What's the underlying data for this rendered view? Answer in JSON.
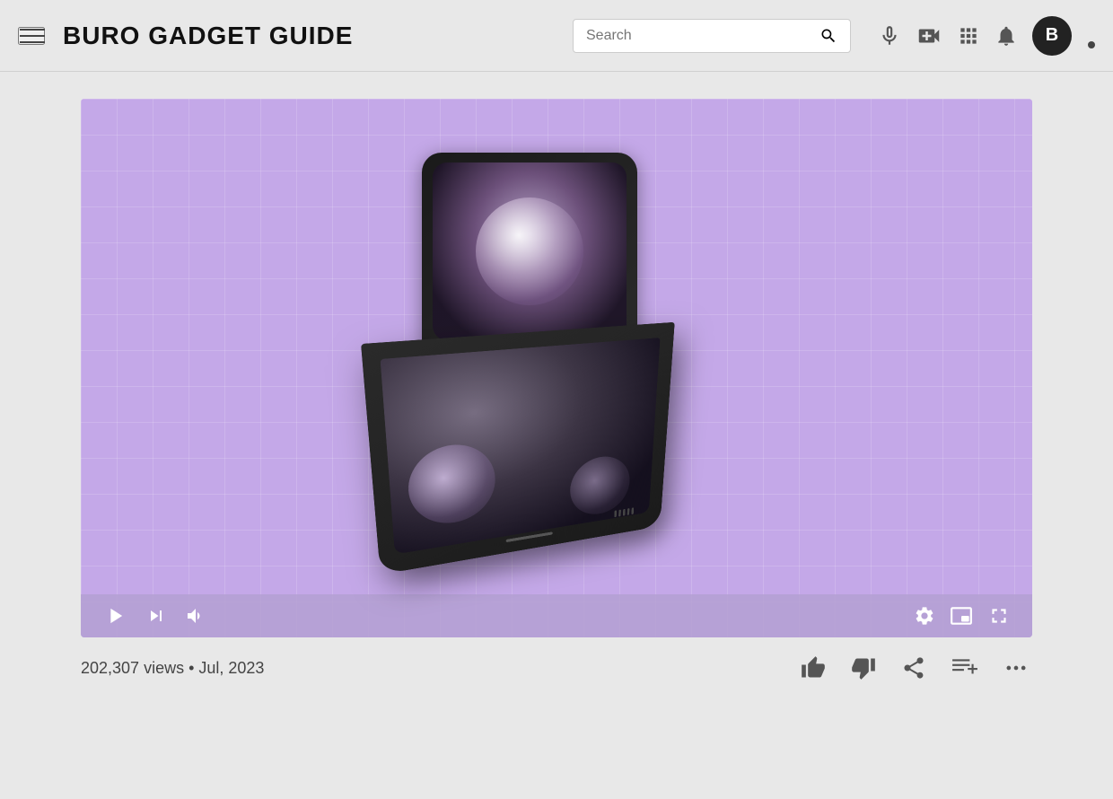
{
  "header": {
    "site_title": "BURO GADGET GUIDE",
    "search_placeholder": "Search",
    "avatar_letter": "B"
  },
  "video": {
    "views": "202,307 views",
    "date": "Jul, 2023",
    "stats_text": "202,307 views • Jul, 2023"
  },
  "icons": {
    "menu": "☰",
    "search": "🔍",
    "mic": "🎤",
    "add_video": "📹",
    "grid": "⊞",
    "bell": "🔔",
    "play": "▶",
    "next": "⏭",
    "volume": "🔊",
    "settings": "⚙",
    "miniplayer": "⬜",
    "fullscreen": "⛶",
    "like": "👍",
    "dislike": "👎",
    "share": "↗",
    "save": "☰+",
    "more": "···"
  }
}
